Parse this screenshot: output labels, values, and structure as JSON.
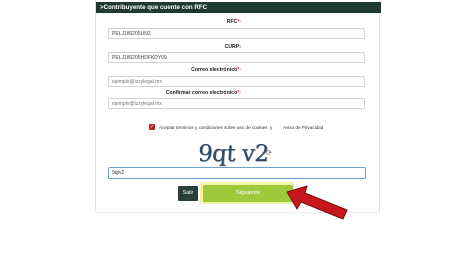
{
  "header": {
    "title": ">Contribuyente que cuente con RFC"
  },
  "fields": [
    {
      "label": "RFC",
      "required_mark": "*:",
      "value": "PELJ180205UN2",
      "placeholder": ""
    },
    {
      "label": "CURP:",
      "required_mark": "",
      "value": "PELJ180205HDFKDY09",
      "placeholder": ""
    },
    {
      "label": "Correo electrónico",
      "required_mark": "*:",
      "value": "",
      "placeholder": "ejemplo@izzylegal.mx"
    },
    {
      "label": "Confirmar correo electrónico",
      "required_mark": "*:",
      "value": "",
      "placeholder": "ejemplo@izzylegal.mx"
    }
  ],
  "terms": {
    "checkbox_icon": "check-icon",
    "checked": true,
    "text": "Aceptar términos y condiciones sobre uso de cookies",
    "conjunction": "y",
    "privacy_link": "Aviso de Privacidad"
  },
  "captcha": {
    "image_text": "9qt v2",
    "refresh_icon": "refresh-icon",
    "input_value": "9qtv2"
  },
  "actions": {
    "exit_label": "Salir",
    "next_label": "Siguiente"
  },
  "annotation": {
    "arrow_icon": "arrow-pointer-icon",
    "arrow_color": "#c8161d"
  },
  "colors": {
    "header_bg": "#1f3a33",
    "next_button": "#9ec93a",
    "highlight": "#f2f5a6",
    "required": "#c21f2a"
  }
}
